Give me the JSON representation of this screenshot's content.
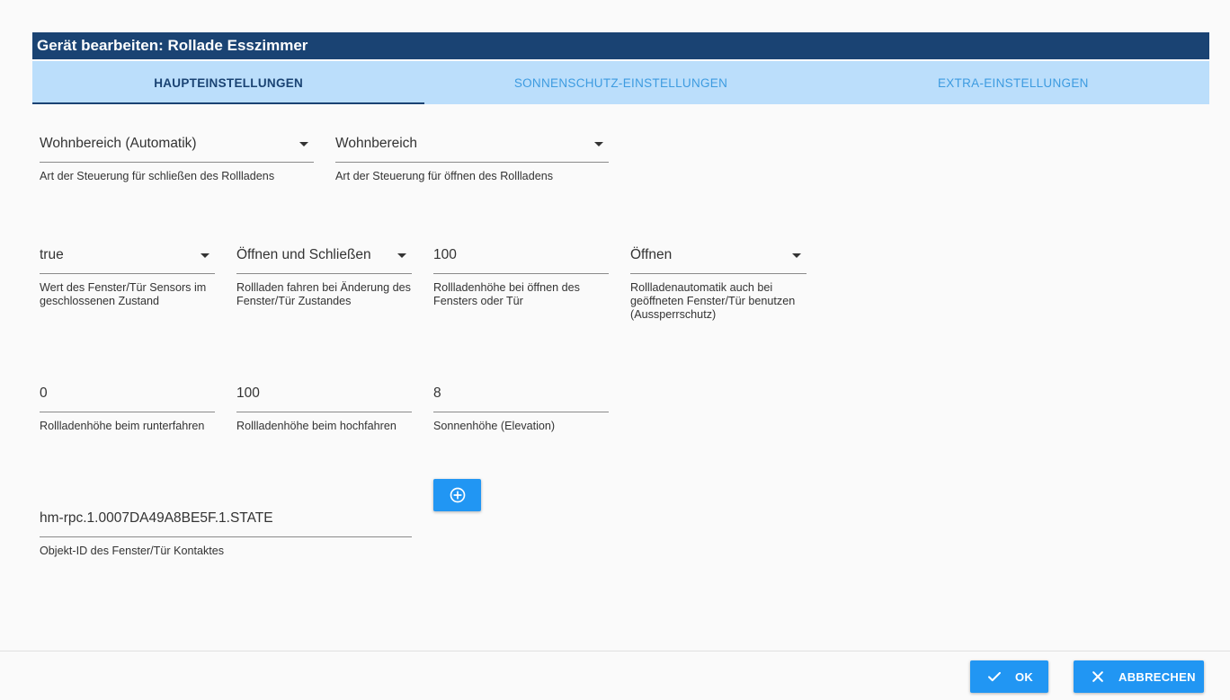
{
  "dialog": {
    "title": "Gerät bearbeiten: Rollade Esszimmer"
  },
  "tabs": [
    {
      "label": "HAUPTEINSTELLUNGEN",
      "active": true
    },
    {
      "label": "SONNENSCHUTZ-EINSTELLUNGEN",
      "active": false
    },
    {
      "label": "EXTRA-EINSTELLUNGEN",
      "active": false
    }
  ],
  "fields": {
    "close_mode": {
      "value": "Wohnbereich (Automatik)",
      "help": "Art der Steuerung für schließen des Rollladens"
    },
    "open_mode": {
      "value": "Wohnbereich",
      "help": "Art der Steuerung für öffnen des Rollladens"
    },
    "sensor_value": {
      "value": "true",
      "help": "Wert des Fenster/Tür Sensors im geschlossenen Zustand"
    },
    "drive_on_change": {
      "value": "Öffnen und Schließen",
      "help": "Rollladen fahren bei Änderung des Fenster/Tür Zustandes"
    },
    "open_height": {
      "value": "100",
      "help": "Rollladenhöhe bei öffnen des Fensters oder Tür"
    },
    "lockout": {
      "value": "Öffnen",
      "help": "Rollladenautomatik auch bei geöffneten Fenster/Tür benutzen (Aussperrschutz)"
    },
    "down_height": {
      "value": "0",
      "help": "Rollladenhöhe beim runterfahren"
    },
    "up_height": {
      "value": "100",
      "help": "Rollladenhöhe beim hochfahren"
    },
    "elevation": {
      "value": "8",
      "help": "Sonnenhöhe (Elevation)"
    },
    "object_id": {
      "value": "hm-rpc.1.0007DA49A8BE5F.1.STATE",
      "help": "Objekt-ID des Fenster/Tür Kontaktes"
    }
  },
  "icons": {
    "add": "plus-circle-icon",
    "ok": "check-icon",
    "cancel": "close-icon"
  },
  "footer": {
    "ok_label": "OK",
    "cancel_label": "ABBRECHEN"
  },
  "colors": {
    "header": "#1a4373",
    "tabs_bg": "#bbdefb",
    "tab_inactive": "#3d9be0",
    "primary": "#2196f3"
  }
}
